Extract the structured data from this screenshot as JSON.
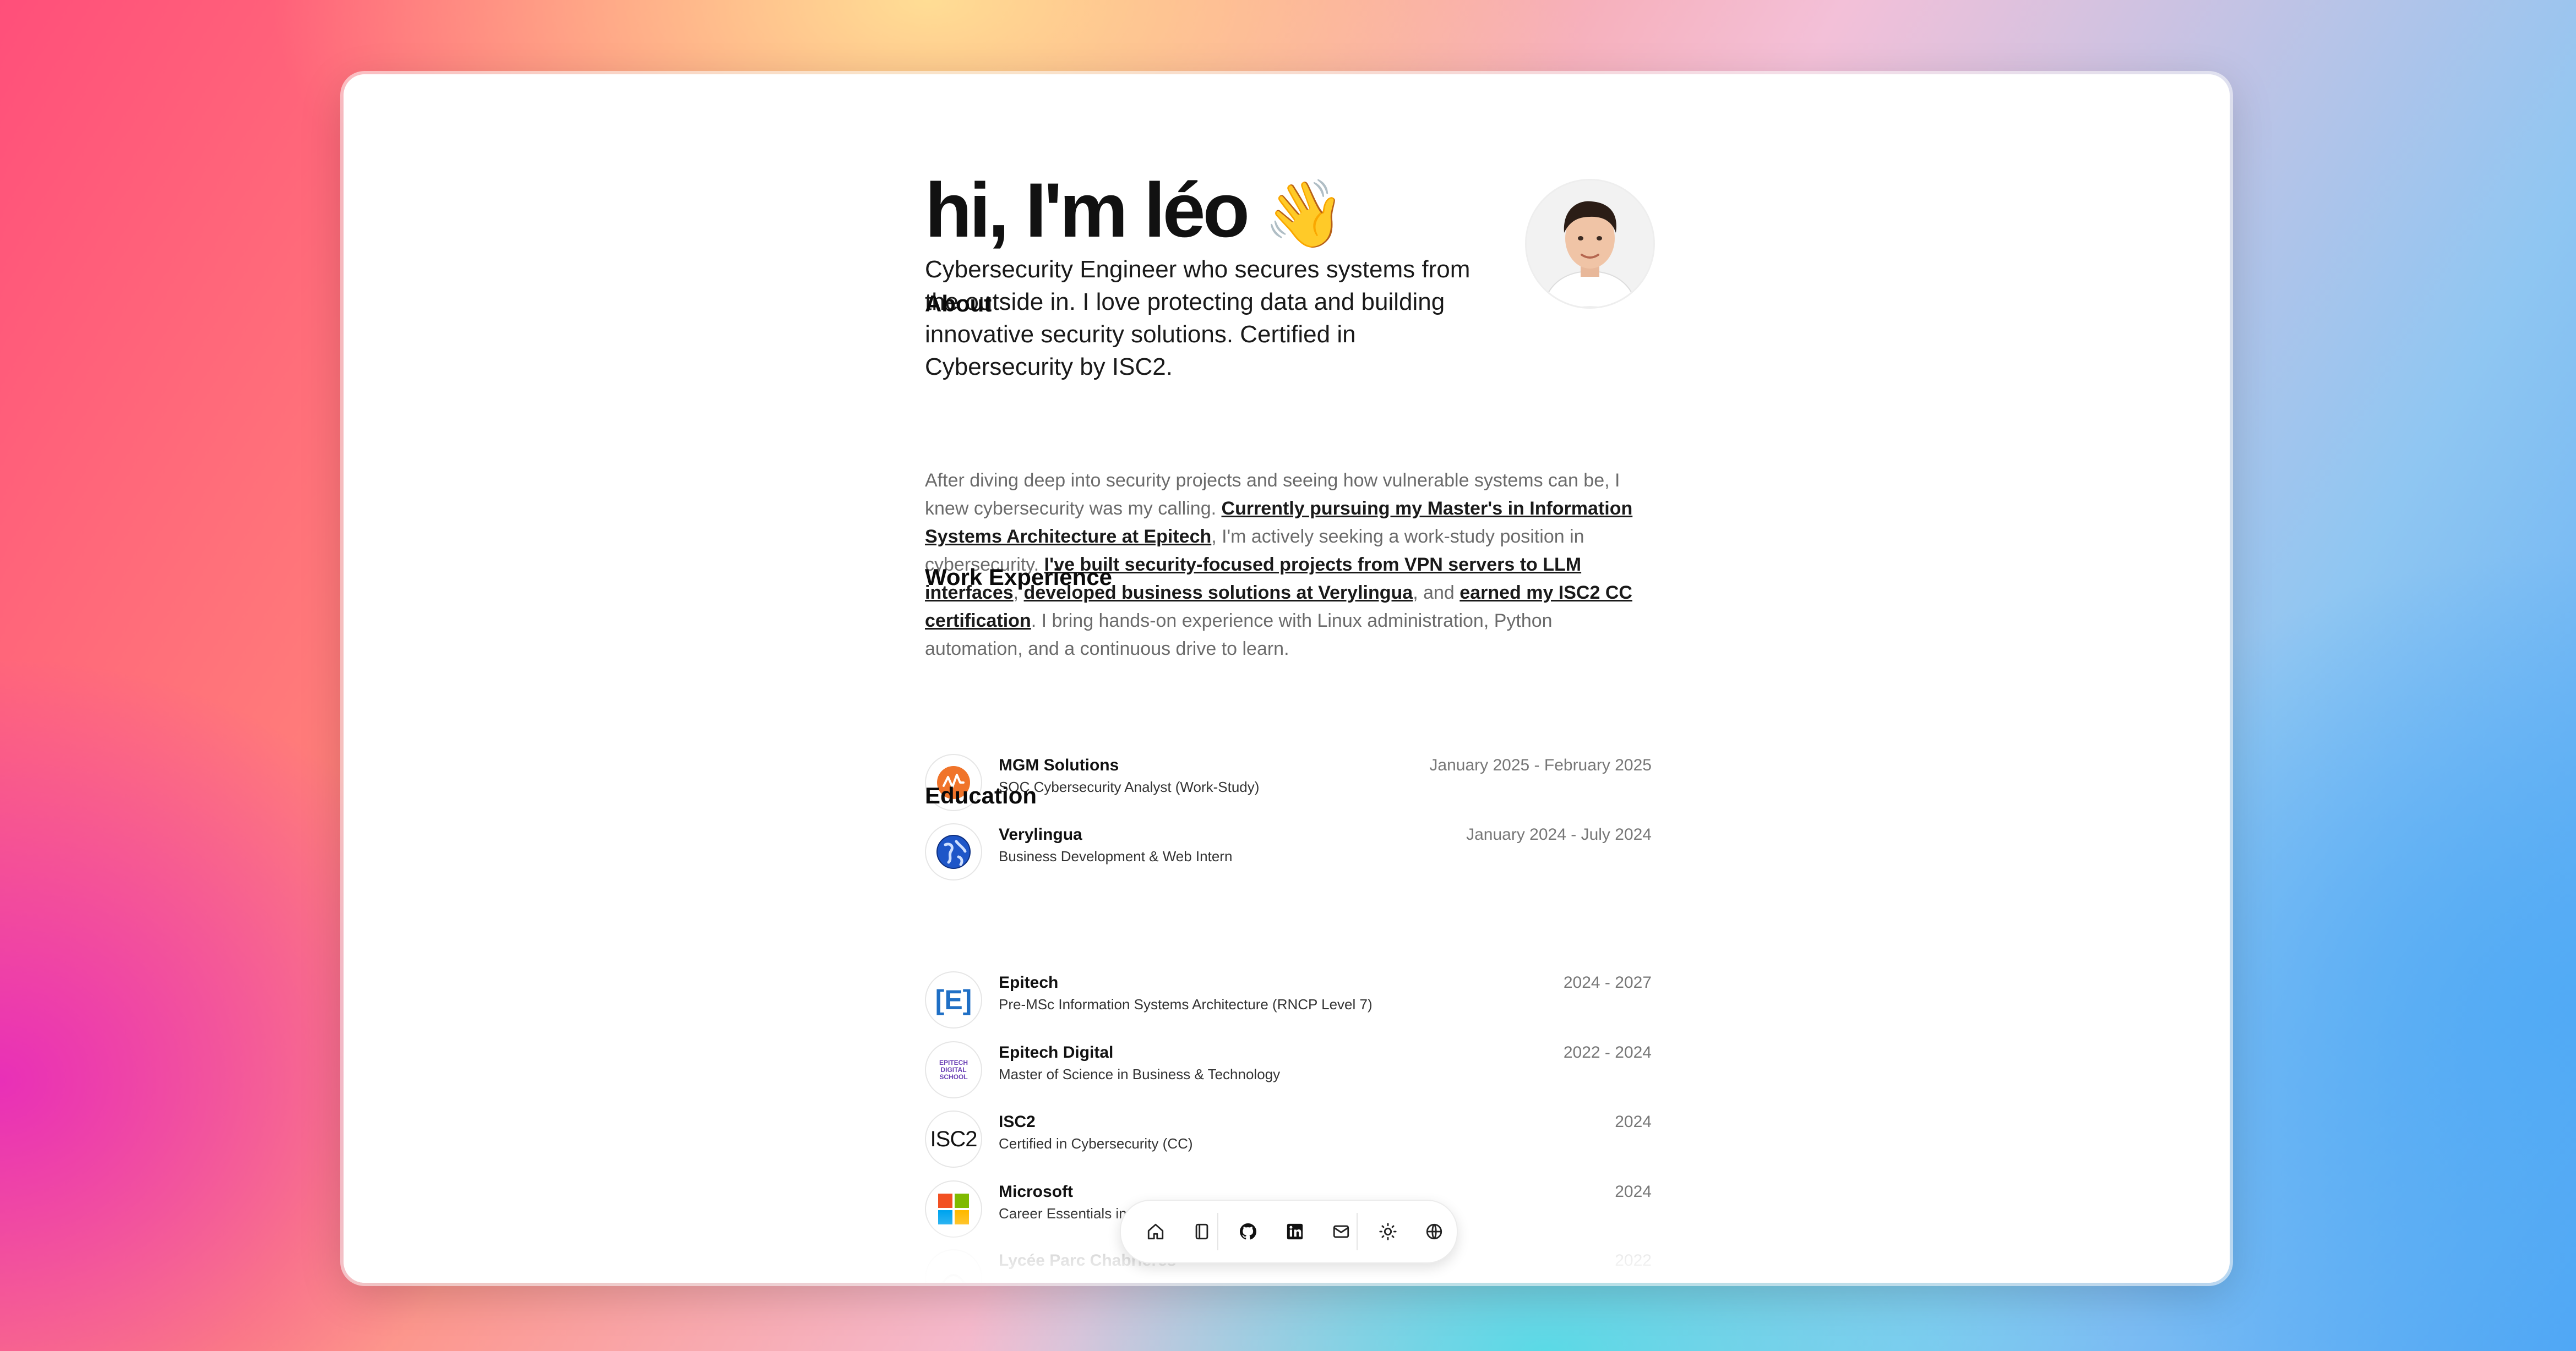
{
  "hero": {
    "title": "hi, I'm léo",
    "emoji": "👋",
    "subtitle": "Cybersecurity Engineer who secures systems from the outside in. I love protecting data and building innovative security solutions. Certified in Cybersecurity by ISC2."
  },
  "about": {
    "heading": "About",
    "text_1": "After diving deep into security projects and seeing how vulnerable systems can be, I knew cybersecurity was my calling. ",
    "link_1": "Currently pursuing my Master's in Information Systems Architecture at Epitech",
    "text_2": ", I'm actively seeking a work-study position in cybersecurity. ",
    "link_2": "I've built security-focused projects from VPN servers to LLM interfaces",
    "text_3": ", ",
    "link_3": "developed business solutions at Verylingua",
    "text_4": ", and ",
    "link_4": "earned my ISC2 CC certification",
    "text_5": ". I bring hands-on experience with Linux administration, Python automation, and a continuous drive to learn."
  },
  "work": {
    "heading": "Work Experience",
    "items": [
      {
        "name": "MGM Solutions",
        "role": "SOC Cybersecurity Analyst (Work-Study)",
        "date": "January 2025 - February 2025"
      },
      {
        "name": "Verylingua",
        "role": "Business Development & Web Intern",
        "date": "January 2024 - July 2024"
      }
    ]
  },
  "education": {
    "heading": "Education",
    "items": [
      {
        "name": "Epitech",
        "role": "Pre-MSc Information Systems Architecture (RNCP Level 7)",
        "date": "2024 - 2027",
        "logo_text": "[E]"
      },
      {
        "name": "Epitech Digital",
        "role": "Master of Science in Business & Technology",
        "date": "2022 - 2024",
        "logo_text": "EPITECH DIGITAL SCHOOL"
      },
      {
        "name": "ISC2",
        "role": "Certified in Cybersecurity (CC)",
        "date": "2024",
        "logo_text": "ISC2"
      },
      {
        "name": "Microsoft",
        "role": "Career Essentials in Cybersecurity",
        "date": "2024"
      },
      {
        "name": "Lycée Parc Chabrières",
        "role": "",
        "date": "2022"
      }
    ]
  },
  "dock": {
    "items": [
      "home-icon",
      "notebook-icon",
      "github-icon",
      "linkedin-icon",
      "mail-icon",
      "sun-icon",
      "globe-icon"
    ]
  },
  "colors": {
    "mgm_orange": "#F0742A",
    "verylingua_blue": "#1E56C8",
    "epitech_blue": "#1F6FC5",
    "epitech_digital_purple": "#6A3FB5"
  }
}
